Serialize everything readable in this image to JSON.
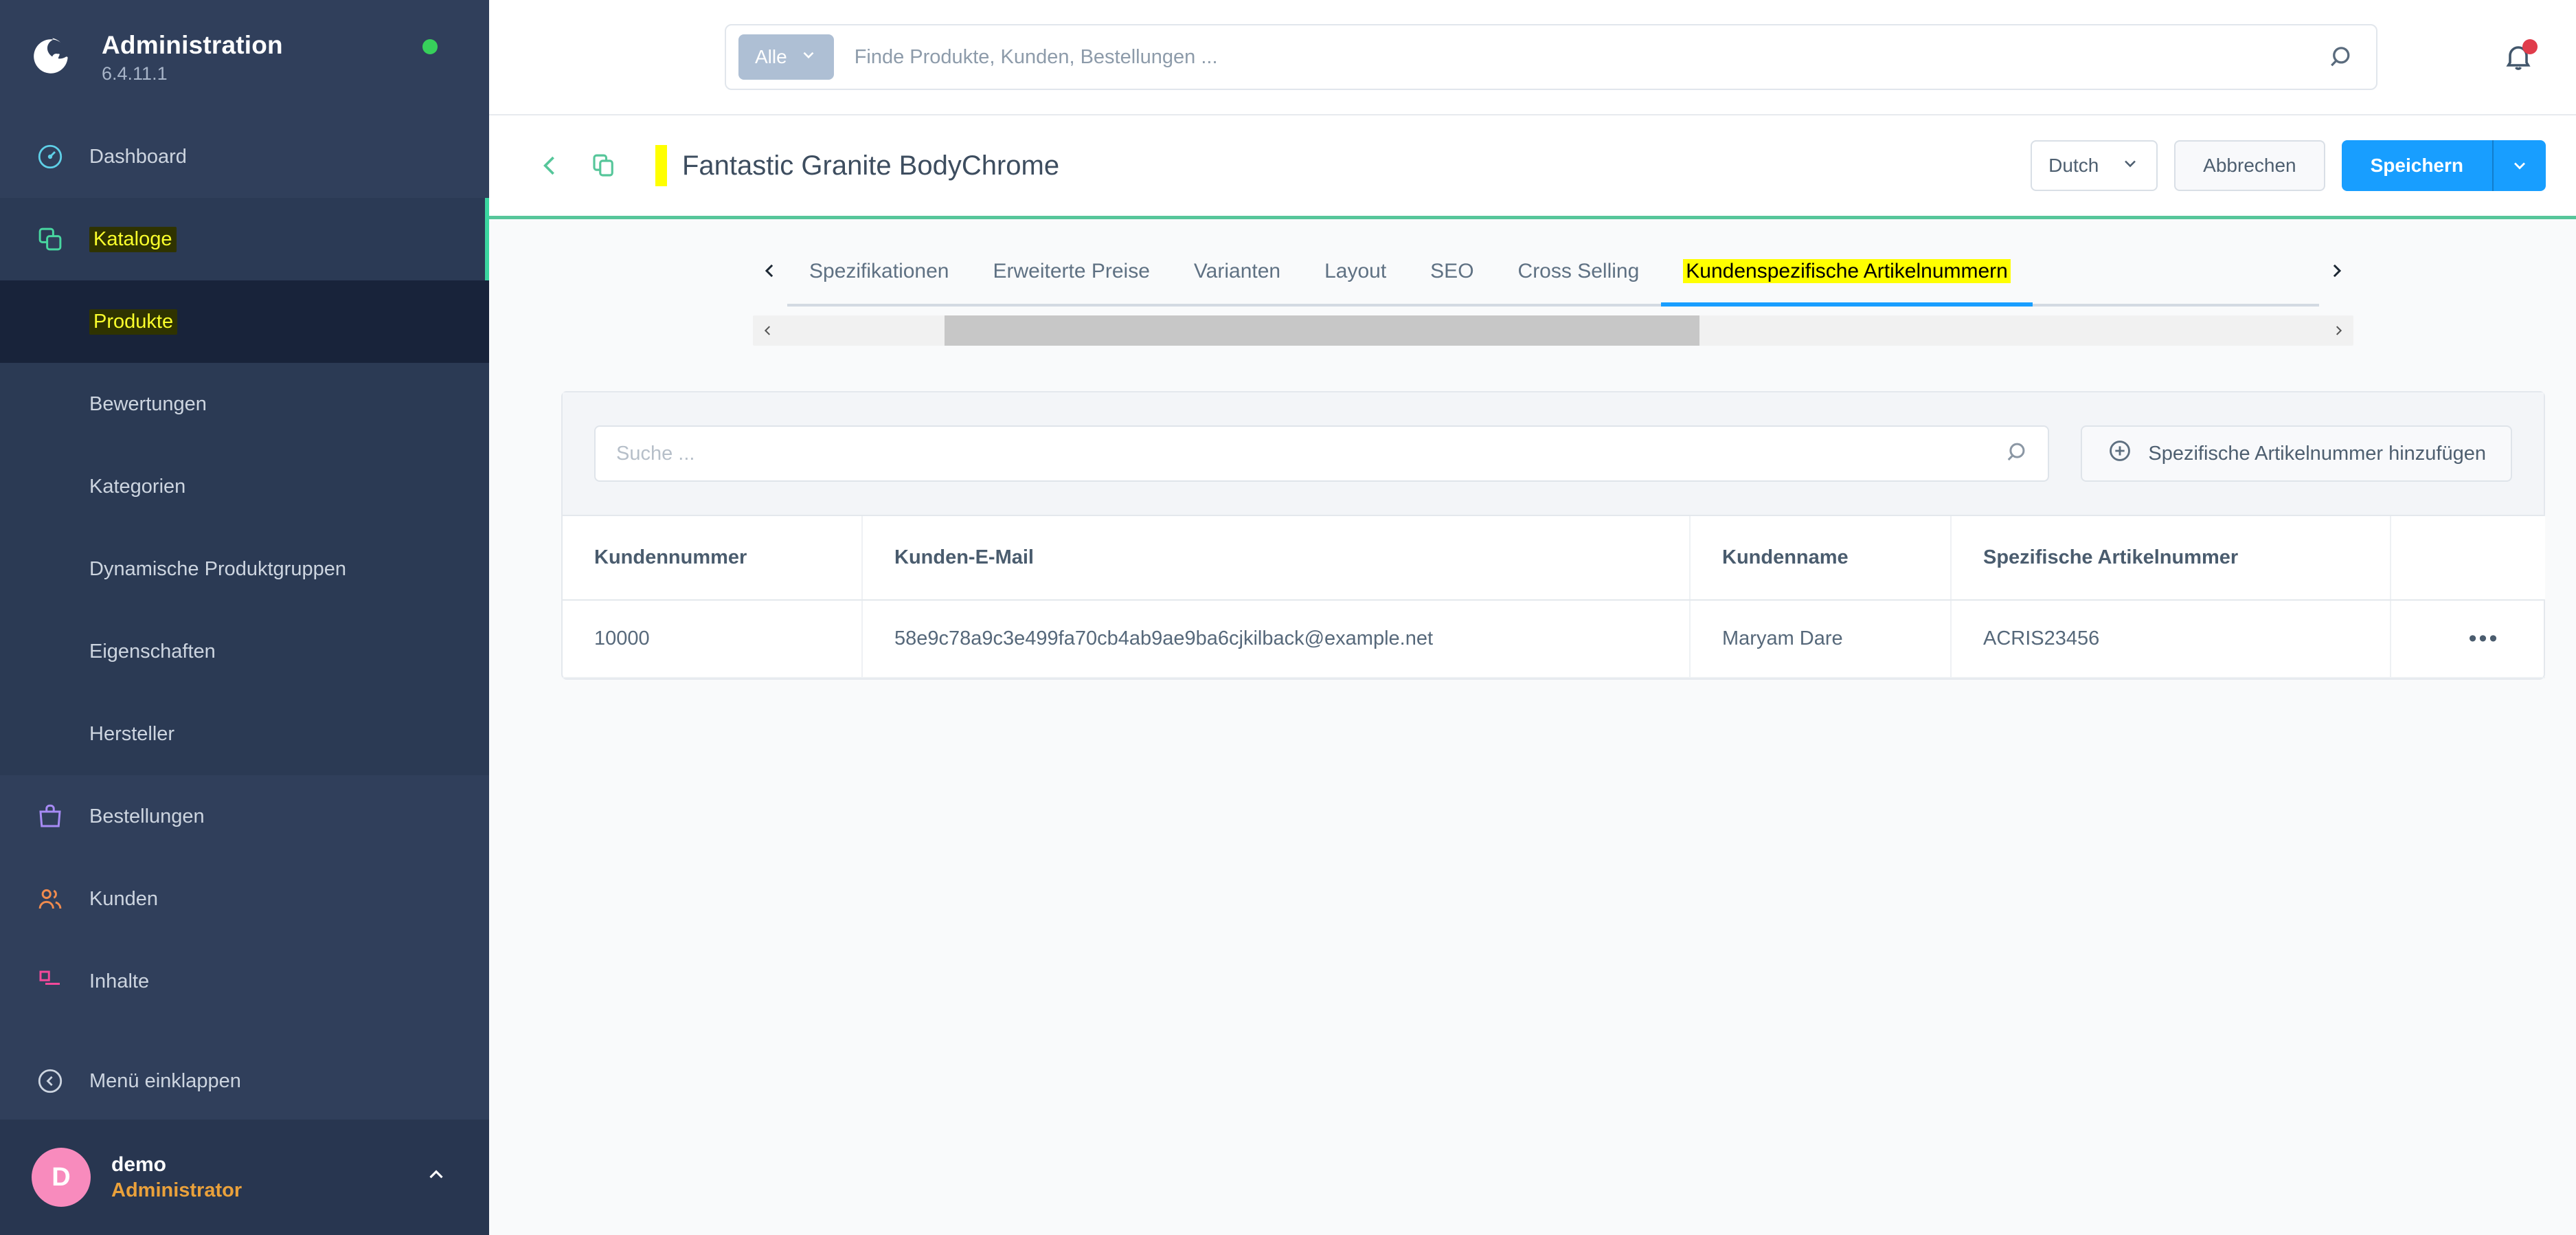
{
  "sidebar": {
    "brand": {
      "title": "Administration",
      "version": "6.4.11.1",
      "status_color": "#37d05b"
    },
    "items": [
      {
        "label": "Dashboard",
        "icon": "dashboard-icon",
        "level": 1
      },
      {
        "label": "Kataloge",
        "icon": "catalog-icon",
        "level": 1,
        "highlight": true
      },
      {
        "label": "Produkte",
        "level": 2,
        "active": true,
        "highlight": true
      },
      {
        "label": "Bewertungen",
        "level": 2
      },
      {
        "label": "Kategorien",
        "level": 2
      },
      {
        "label": "Dynamische Produktgruppen",
        "level": 2
      },
      {
        "label": "Eigenschaften",
        "level": 2
      },
      {
        "label": "Hersteller",
        "level": 2
      },
      {
        "label": "Bestellungen",
        "icon": "bag-icon",
        "level": 1
      },
      {
        "label": "Kunden",
        "icon": "customers-icon",
        "level": 1
      },
      {
        "label": "Inhalte",
        "icon": "content-icon",
        "level": 1
      }
    ],
    "collapse": {
      "label": "Menü einklappen",
      "icon": "collapse-left-icon"
    },
    "user": {
      "initial": "D",
      "name": "demo",
      "role": "Administrator",
      "caret": "chevron-up-icon"
    }
  },
  "topbar": {
    "scope_label": "Alle",
    "search_placeholder": "Finde Produkte, Kunden, Bestellungen ...",
    "search_value": "",
    "search_icon": "search-icon",
    "bell_icon": "bell-icon",
    "bell_badge_color": "#e03c4b"
  },
  "pagehead": {
    "back_icon": "chevron-left-icon",
    "duplicate_icon": "duplicate-icon",
    "title": "Fantastic Granite BodyChrome",
    "language": "Dutch",
    "cancel_label": "Abbrechen",
    "save_label": "Speichern",
    "accent_color": "#189eff",
    "bottom_border_color": "#56c69a"
  },
  "tabs": {
    "prev_arrow": "chevron-left-icon",
    "next_arrow": "chevron-right-icon",
    "items": [
      {
        "label": "Spezifikationen",
        "active": false
      },
      {
        "label": "Erweiterte Preise",
        "active": false
      },
      {
        "label": "Varianten",
        "active": false
      },
      {
        "label": "Layout",
        "active": false
      },
      {
        "label": "SEO",
        "active": false
      },
      {
        "label": "Cross Selling",
        "active": false
      },
      {
        "label": "Kundenspezifische Artikelnummern",
        "active": true,
        "highlight": true
      }
    ]
  },
  "scrollbar": {
    "left_arrow": "chevron-left-icon",
    "right_arrow": "chevron-right-icon"
  },
  "card": {
    "search_placeholder": "Suche ...",
    "search_value": "",
    "search_icon": "search-icon",
    "add_button_label": "Spezifische Artikelnummer hinzufügen",
    "add_button_icon": "plus-circle-icon",
    "columns": [
      "Kundennummer",
      "Kunden-E-Mail",
      "Kundenname",
      "Spezifische Artikelnummer",
      ""
    ],
    "rows": [
      {
        "customer_number": "10000",
        "customer_email": "58e9c78a9c3e499fa70cb4ab9ae9ba6cjkilback@example.net",
        "customer_name": "Maryam Dare",
        "specific_sku": "ACRIS23456",
        "actions": "•••"
      }
    ]
  }
}
